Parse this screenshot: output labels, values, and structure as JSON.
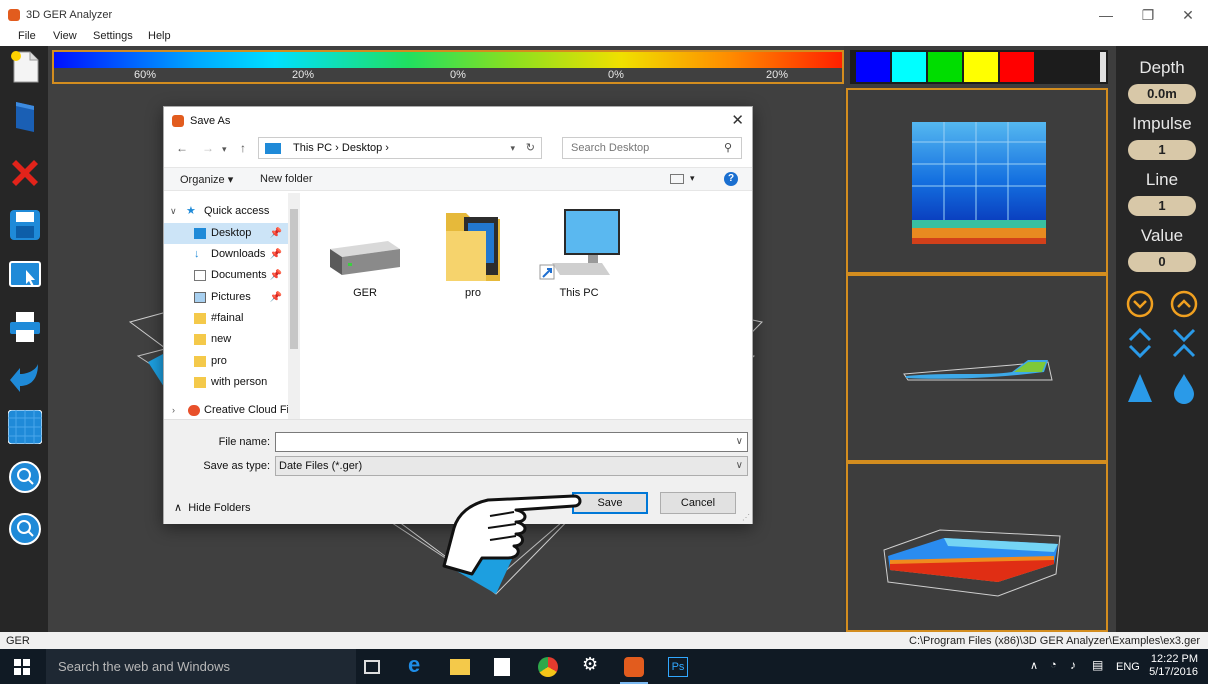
{
  "window": {
    "title": "3D GER Analyzer",
    "controls": [
      "—",
      "❐",
      "✕"
    ]
  },
  "menu": [
    "File",
    "View",
    "Settings",
    "Help"
  ],
  "colorbar": {
    "labels": [
      "60%",
      "20%",
      "0%",
      "0%",
      "20%"
    ]
  },
  "palette": {
    "colors": [
      "#0000ff",
      "#00ffff",
      "#00dd00",
      "#ffff00",
      "#ff0000"
    ]
  },
  "right_panel": {
    "depth_label": "Depth",
    "depth_value": "0.0m",
    "impulse_label": "Impulse",
    "impulse_value": "1",
    "line_label": "Line",
    "line_value": "1",
    "value_label": "Value",
    "value_value": "0"
  },
  "dialog": {
    "title": "Save As",
    "breadcrumb": "This PC  ›  Desktop  ›",
    "search_placeholder": "Search Desktop",
    "organize": "Organize ▾",
    "new_folder": "New folder",
    "nav": {
      "quick_access": "Quick access",
      "items": [
        {
          "label": "Desktop",
          "pinned": true,
          "selected": true
        },
        {
          "label": "Downloads",
          "pinned": true
        },
        {
          "label": "Documents",
          "pinned": true
        },
        {
          "label": "Pictures",
          "pinned": true
        },
        {
          "label": "#fainal"
        },
        {
          "label": "new"
        },
        {
          "label": "pro"
        },
        {
          "label": "with person"
        }
      ],
      "creative_cloud": "Creative Cloud Fil"
    },
    "files": [
      {
        "name": "GER",
        "icon": "drive-icon"
      },
      {
        "name": "pro",
        "icon": "folder-icon"
      },
      {
        "name": "This PC",
        "icon": "computer-icon"
      }
    ],
    "file_name_label": "File name:",
    "file_name_value": "",
    "save_as_type_label": "Save as type:",
    "save_as_type_value": "Date Files (*.ger)",
    "hide_folders": "Hide Folders",
    "save": "Save",
    "cancel": "Cancel"
  },
  "status": {
    "left": "GER",
    "right": "C:\\Program Files (x86)\\3D GER Analyzer\\Examples\\ex3.ger"
  },
  "taskbar": {
    "search": "Search the web and Windows",
    "lang": "ENG",
    "time": "12:22 PM",
    "date": "5/17/2016",
    "ps_label": "Ps"
  }
}
